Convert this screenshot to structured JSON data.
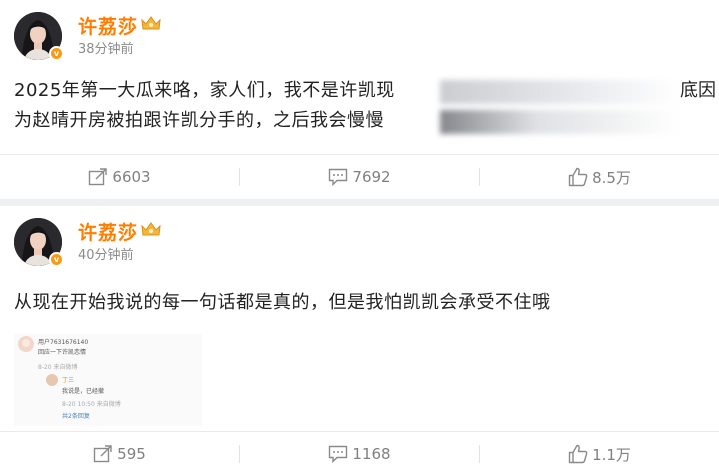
{
  "posts": [
    {
      "username": "许荔莎",
      "time": "38分钟前",
      "text_line1": "2025年第一大瓜来咯，家人们，我不是许凯现",
      "text_line1_tail": "底因",
      "text_line2": "为赵晴开房被拍跟许凯分手的，之后我会慢慢",
      "repost_count": "6603",
      "comment_count": "7692",
      "like_count": "8.5万"
    },
    {
      "username": "许荔莎",
      "time": "40分钟前",
      "text_line1": "从现在开始我说的每一句话都是真的，但是我怕凯凯会承受不住哦",
      "repost_count": "595",
      "comment_count": "1168",
      "like_count": "1.1万",
      "screenshot": {
        "comment_user": "用户7631676140",
        "comment_text": "回应一下许凯恋情",
        "comment_meta": "8-20 来自微博",
        "reply_user": "丁三",
        "reply_text": "我说是，已经撤",
        "reply_meta": "8-20 10:50 来自微博",
        "more_replies": "共2条回复"
      }
    }
  ],
  "icons": {
    "repost": "repost-icon",
    "comment": "comment-icon",
    "like": "like-icon",
    "verified": "verified-badge-icon",
    "crown": "crown-icon"
  },
  "colors": {
    "username": "#ff7e00",
    "verified": "#f79a19",
    "meta": "#8b8b8b"
  }
}
